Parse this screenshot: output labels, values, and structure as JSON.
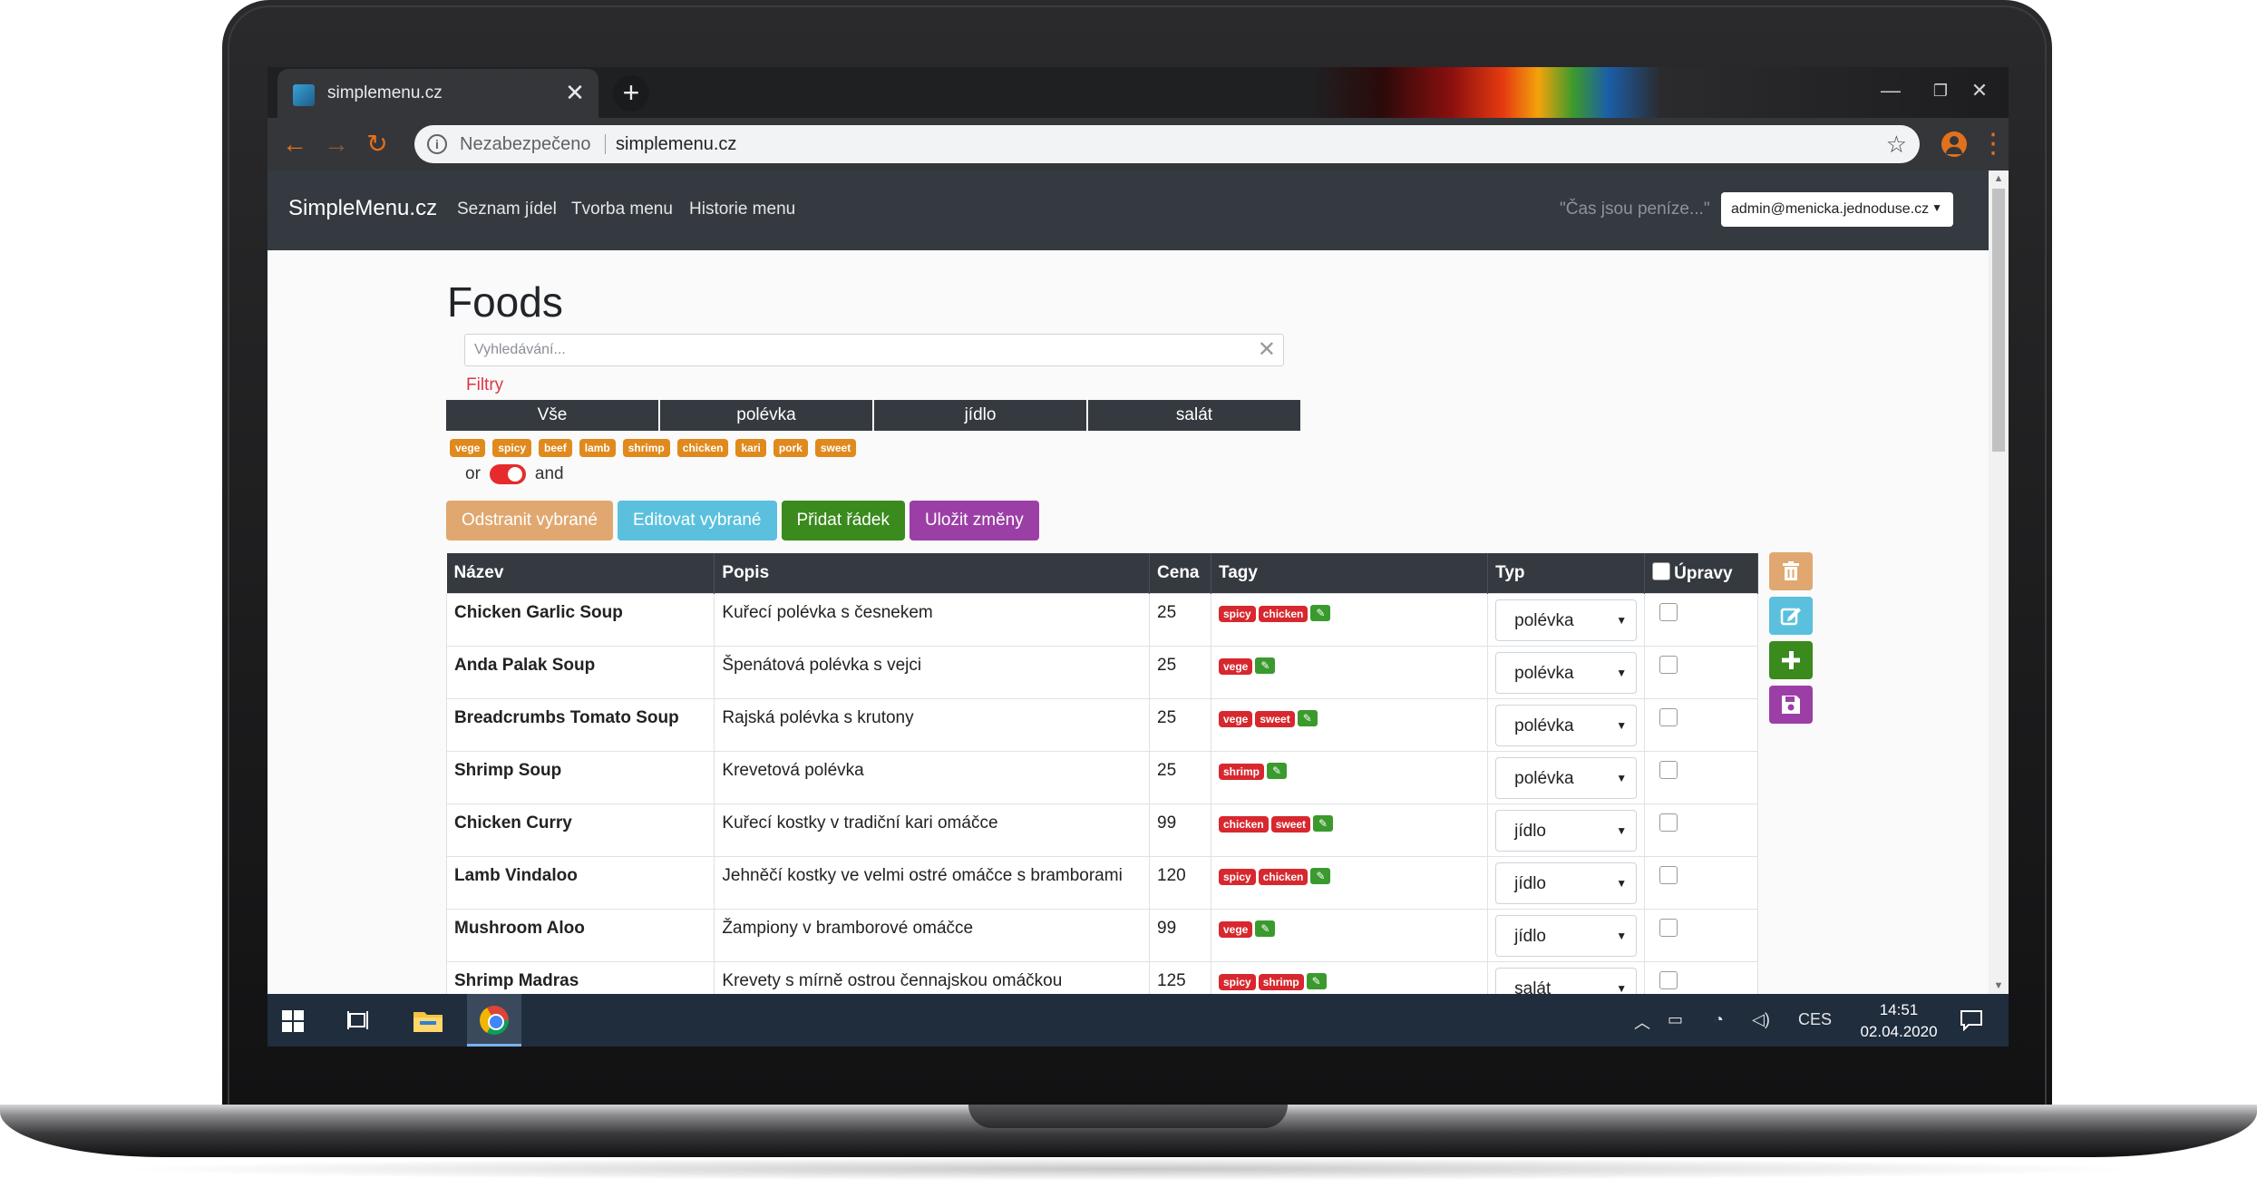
{
  "browser": {
    "tab_title": "simplemenu.cz",
    "tab_close": "✕",
    "new_tab": "+",
    "address_insecure": "Nezabezpečeno",
    "address_url": "simplemenu.cz",
    "window_controls": [
      "—",
      "❐",
      "✕"
    ]
  },
  "navbar": {
    "brand": "SimpleMenu.cz",
    "links": [
      "Seznam jídel",
      "Tvorba menu",
      "Historie menu"
    ],
    "quote": "\"Čas jsou peníze...\"",
    "user": "admin@menicka.jednoduse.cz"
  },
  "page": {
    "title": "Foods",
    "search_placeholder": "Vyhledávání...",
    "filters_label": "Filtry",
    "type_tabs": [
      "Vše",
      "polévka",
      "jídlo",
      "salát"
    ],
    "tag_filters": [
      "vege",
      "spicy",
      "beef",
      "lamb",
      "shrimp",
      "chicken",
      "kari",
      "pork",
      "sweet"
    ],
    "logic_or": "or",
    "logic_and": "and",
    "actions": {
      "delete": "Odstranit vybrané",
      "edit": "Editovat vybrané",
      "add": "Přidat řádek",
      "save": "Uložit změny"
    }
  },
  "table": {
    "headers": [
      "Název",
      "Popis",
      "Cena",
      "Tagy",
      "Typ",
      "Úpravy"
    ],
    "rows": [
      {
        "name": "Chicken Garlic Soup",
        "desc": "Kuřecí polévka s česnekem",
        "price": "25",
        "tags": [
          "spicy",
          "chicken"
        ],
        "type": "polévka"
      },
      {
        "name": "Anda Palak Soup",
        "desc": "Špenátová polévka s vejci",
        "price": "25",
        "tags": [
          "vege"
        ],
        "type": "polévka"
      },
      {
        "name": "Breadcrumbs Tomato Soup",
        "desc": "Rajská polévka s krutony",
        "price": "25",
        "tags": [
          "vege",
          "sweet"
        ],
        "type": "polévka"
      },
      {
        "name": "Shrimp Soup",
        "desc": "Krevetová polévka",
        "price": "25",
        "tags": [
          "shrimp"
        ],
        "type": "polévka"
      },
      {
        "name": "Chicken Curry",
        "desc": "Kuřecí kostky v tradiční kari omáčce",
        "price": "99",
        "tags": [
          "chicken",
          "sweet"
        ],
        "type": "jídlo"
      },
      {
        "name": "Lamb Vindaloo",
        "desc": "Jehněčí kostky ve velmi ostré omáčce s bramborami",
        "price": "120",
        "tags": [
          "spicy",
          "chicken"
        ],
        "type": "jídlo"
      },
      {
        "name": "Mushroom Aloo",
        "desc": "Žampiony v bramborové omáčce",
        "price": "99",
        "tags": [
          "vege"
        ],
        "type": "jídlo"
      },
      {
        "name": "Shrimp Madras",
        "desc": "Krevety s mírně ostrou čennajskou omáčkou",
        "price": "125",
        "tags": [
          "spicy",
          "shrimp"
        ],
        "type": "salát"
      }
    ]
  },
  "taskbar": {
    "language": "CES",
    "time": "14:51",
    "date": "02.04.2020"
  },
  "colors": {
    "navbar": "#343a40",
    "tag_filter": "#e08a1e",
    "tag": "#d7282f",
    "delete_btn": "#e0a870",
    "edit_btn": "#5bc0de",
    "add_btn": "#3a8a1e",
    "save_btn": "#9b3fa6"
  }
}
